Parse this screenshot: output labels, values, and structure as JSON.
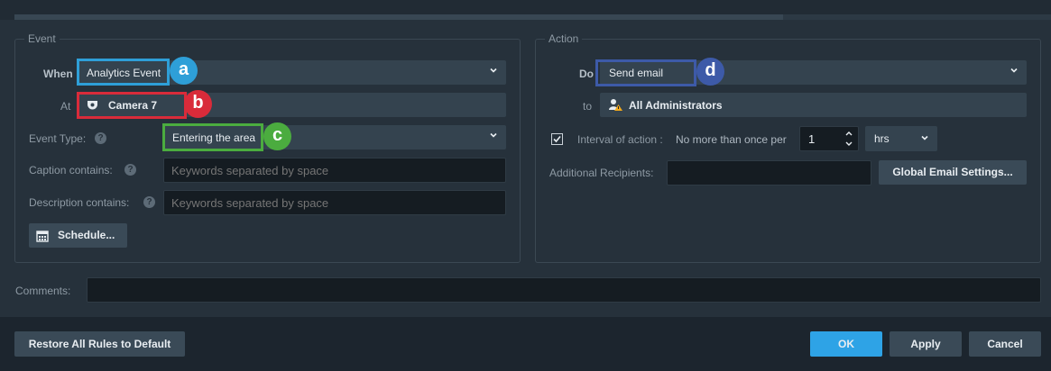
{
  "event": {
    "legend": "Event",
    "when_label": "When",
    "when_value": "Analytics Event",
    "at_label": "At",
    "at_value": "Camera 7",
    "event_type_label": "Event Type:",
    "event_type_value": "Entering the area",
    "caption_label": "Caption contains:",
    "caption_placeholder": "Keywords separated by space",
    "description_label": "Description contains:",
    "description_placeholder": "Keywords separated by space",
    "schedule_label": "Schedule..."
  },
  "action": {
    "legend": "Action",
    "do_label": "Do",
    "do_value": "Send email",
    "to_label": "to",
    "to_value": "All Administrators",
    "interval_label": "Interval of action :",
    "interval_text": "No more than once per",
    "interval_value": "1",
    "interval_unit": "hrs",
    "interval_checked": true,
    "recipients_label": "Additional Recipients:",
    "global_email_label": "Global Email Settings..."
  },
  "comments_label": "Comments:",
  "footer": {
    "restore_label": "Restore All Rules to Default",
    "ok_label": "OK",
    "apply_label": "Apply",
    "cancel_label": "Cancel"
  },
  "annotations": [
    {
      "letter": "a",
      "color": "#2e9fd8"
    },
    {
      "letter": "b",
      "color": "#d92b3a"
    },
    {
      "letter": "c",
      "color": "#4bac3f"
    },
    {
      "letter": "d",
      "color": "#3d5aa8"
    }
  ],
  "colors": {
    "background": "#26313b",
    "accent": "#2ea3e6",
    "field": "#34434f"
  }
}
